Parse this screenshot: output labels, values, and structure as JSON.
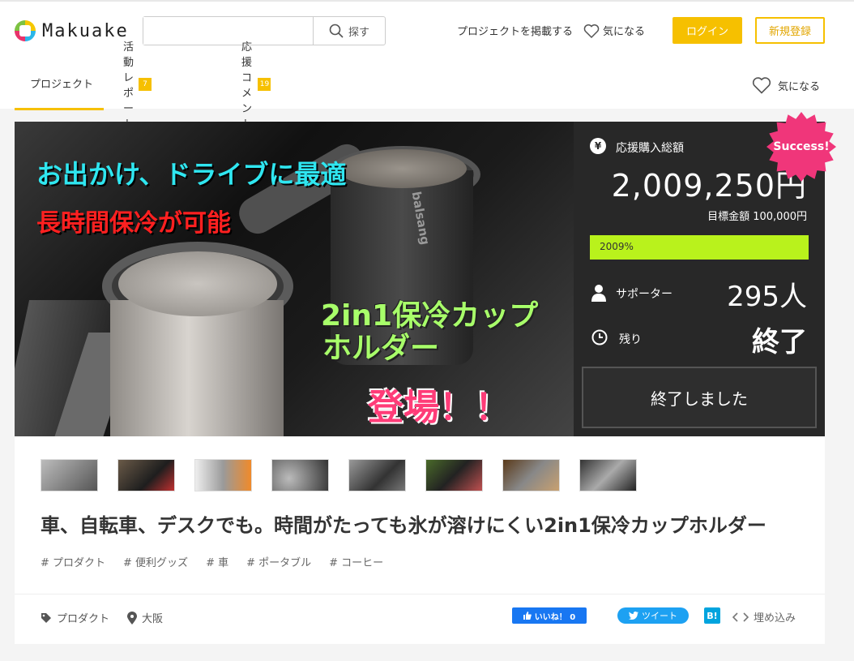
{
  "header": {
    "logo_text": "Makuake",
    "search_placeholder": "",
    "search_button": "探す",
    "post_project": "プロジェクトを掲載する",
    "favorite": "気になる",
    "login": "ログイン",
    "register": "新規登録"
  },
  "tabs": [
    {
      "label": "プロジェクト",
      "count": ""
    },
    {
      "label": "活動レポート",
      "count": "7"
    },
    {
      "label": "応援コメント",
      "count": "19"
    }
  ],
  "fav_tab": "気になる",
  "hero": {
    "line1": "お出かけ、ドライブに最適",
    "line2": "長時間保冷が可能",
    "line3a": "2in1保冷カップ",
    "line3b": "ホルダー",
    "line4": "登場！！",
    "cup_brand": "balsang"
  },
  "stats": {
    "currency_icon": "¥",
    "total_label": "応援購入総額",
    "total_amount": "2,009,250円",
    "goal": "目標金額 100,000円",
    "progress_text": "2009%",
    "progress_ratio": 1.0,
    "supporter_label": "サポーター",
    "supporter_count": "295人",
    "remaining_label": "残り",
    "remaining_value": "終了",
    "ended_button": "終了しました",
    "success_badge": "Success!"
  },
  "project": {
    "title": "車、自転車、デスクでも。時間がたっても氷が溶けにくい2in1保冷カップホルダー",
    "tags": [
      "# プロダクト",
      "# 便利グッズ",
      "# 車",
      "# ポータブル",
      "# コーヒー"
    ],
    "category": "プロダクト",
    "location": "大阪",
    "like_button": "いいね！ 0",
    "tweet_button": "ツイート",
    "hatena_button": "B!",
    "embed": "埋め込み"
  },
  "colors": {
    "brand_yellow": "#f6c000",
    "progress_green": "#b9f21c",
    "panel_bg": "#282828",
    "success_pink": "#f0367a"
  }
}
